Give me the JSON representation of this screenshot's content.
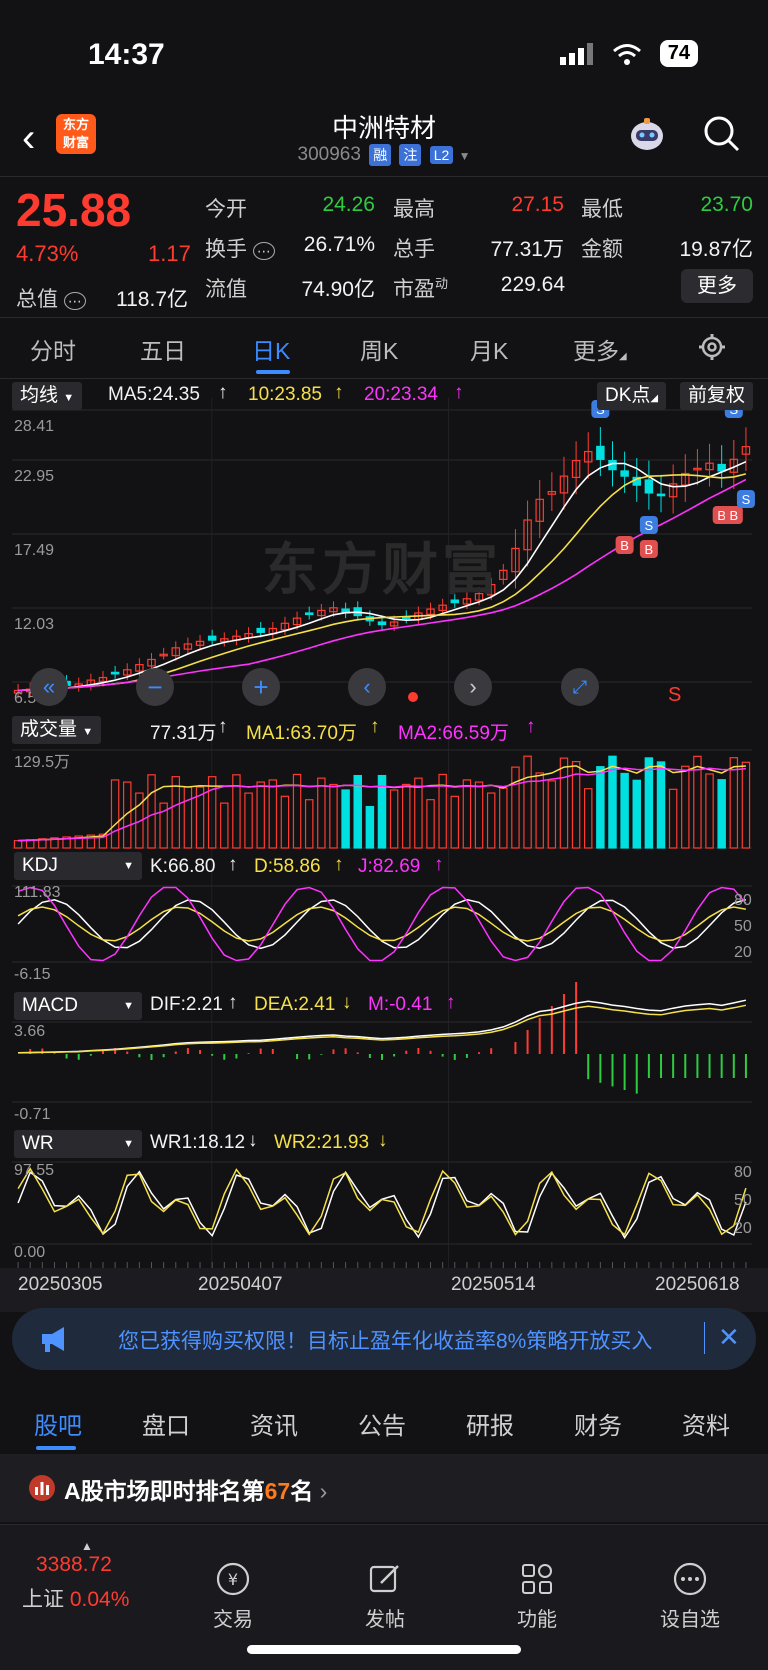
{
  "status_bar": {
    "time": "14:37",
    "battery": "74"
  },
  "header": {
    "logo_line1": "东方",
    "logo_line2": "财富",
    "stock_name": "中洲特材",
    "stock_code": "300963",
    "tags": [
      "融",
      "注",
      "L2"
    ]
  },
  "quote": {
    "price": "25.88",
    "pct_change": "4.73%",
    "change": "1.17",
    "market_cap_label": "总值",
    "market_cap": "118.7亿",
    "fields": [
      {
        "label": "今开",
        "value": "24.26",
        "color": "green"
      },
      {
        "label": "最高",
        "value": "27.15",
        "color": "red"
      },
      {
        "label": "最低",
        "value": "23.70",
        "color": "green"
      },
      {
        "label": "换手",
        "value": "26.71%",
        "color": "white"
      },
      {
        "label": "总手",
        "value": "77.31万",
        "color": "white"
      },
      {
        "label": "金额",
        "value": "19.87亿",
        "color": "white"
      },
      {
        "label": "流值",
        "value": "74.90亿",
        "color": "white"
      },
      {
        "label": "市盈",
        "label_sup": "动",
        "value": "229.64",
        "color": "white"
      }
    ],
    "more_label": "更多"
  },
  "period_tabs": [
    "分时",
    "五日",
    "日K",
    "周K",
    "月K",
    "更多"
  ],
  "active_period_tab": "日K",
  "kline": {
    "indicator_btn": "均线",
    "ma5": "MA5:24.35",
    "ma10": "10:23.85",
    "ma20": "20:23.34",
    "dk_btn": "DK点",
    "adjust_btn": "前复权",
    "y_labels": [
      "28.41",
      "22.95",
      "17.49",
      "12.03",
      "6.57"
    ],
    "watermark": "东方财富",
    "buy_marker": "B",
    "sell_marker": "S"
  },
  "volume": {
    "btn": "成交量",
    "value": "77.31万",
    "ma1": "MA1:63.70万",
    "ma2": "MA2:66.59万",
    "y_top": "129.5万"
  },
  "kdj": {
    "btn": "KDJ",
    "k": "K:66.80",
    "d": "D:58.86",
    "j": "J:82.69",
    "y_top": "111.83",
    "y_bottom": "-6.15",
    "levels": [
      "80",
      "50",
      "20"
    ]
  },
  "macd": {
    "btn": "MACD",
    "dif": "DIF:2.21",
    "dea": "DEA:2.41",
    "m": "M:-0.41",
    "y_top": "3.66",
    "y_bottom": "-0.71"
  },
  "wr": {
    "btn": "WR",
    "wr1": "WR1:18.12",
    "wr2": "WR2:21.93",
    "y_top": "97.55",
    "y_bottom": "0.00",
    "levels": [
      "80",
      "50",
      "20"
    ]
  },
  "dates": [
    "20250305",
    "20250407",
    "20250514",
    "20250618"
  ],
  "chart_data": {
    "type": "candlestick",
    "dates_shown": [
      "20250305",
      "20250407",
      "20250514",
      "20250618"
    ],
    "ylim": [
      6.57,
      28.41
    ],
    "close_series_approx": [
      7.0,
      7.1,
      7.2,
      7.3,
      7.4,
      7.5,
      7.8,
      8.0,
      8.3,
      8.6,
      9.0,
      9.4,
      9.8,
      10.3,
      10.6,
      10.8,
      10.9,
      11.0,
      11.2,
      11.4,
      11.5,
      11.8,
      12.2,
      12.6,
      12.9,
      13.2,
      13.4,
      13.0,
      12.8,
      12.4,
      12.1,
      12.3,
      12.6,
      13.0,
      13.3,
      13.6,
      13.8,
      14.1,
      14.5,
      15.2,
      16.3,
      18.0,
      20.2,
      21.8,
      22.4,
      23.6,
      24.8,
      25.5,
      24.9,
      24.1,
      23.6,
      22.9,
      22.3,
      22.1,
      23.0,
      23.8,
      24.2,
      24.6,
      24.0,
      24.9,
      25.88
    ]
  },
  "banner": {
    "text": "您已获得购买权限！目标止盈年化收益率8%策略开放买入"
  },
  "bottom_tabs": [
    "股吧",
    "盘口",
    "资讯",
    "公告",
    "研报",
    "财务",
    "资料"
  ],
  "active_bottom_tab": "股吧",
  "rank": {
    "prefix": "A股市场即时排名第",
    "rank": "67",
    "suffix": "名"
  },
  "toolbar": {
    "index_value": "3388.72",
    "index_name": "上证",
    "index_pct": "0.04%",
    "items": [
      "交易",
      "发帖",
      "功能",
      "设自选"
    ]
  },
  "colors": {
    "up": "#ff3b30",
    "down": "#00e0e0",
    "accent": "#3d8cff",
    "ma5": "#ffffff",
    "ma10": "#f5e04a",
    "ma20": "#ff33ff"
  }
}
